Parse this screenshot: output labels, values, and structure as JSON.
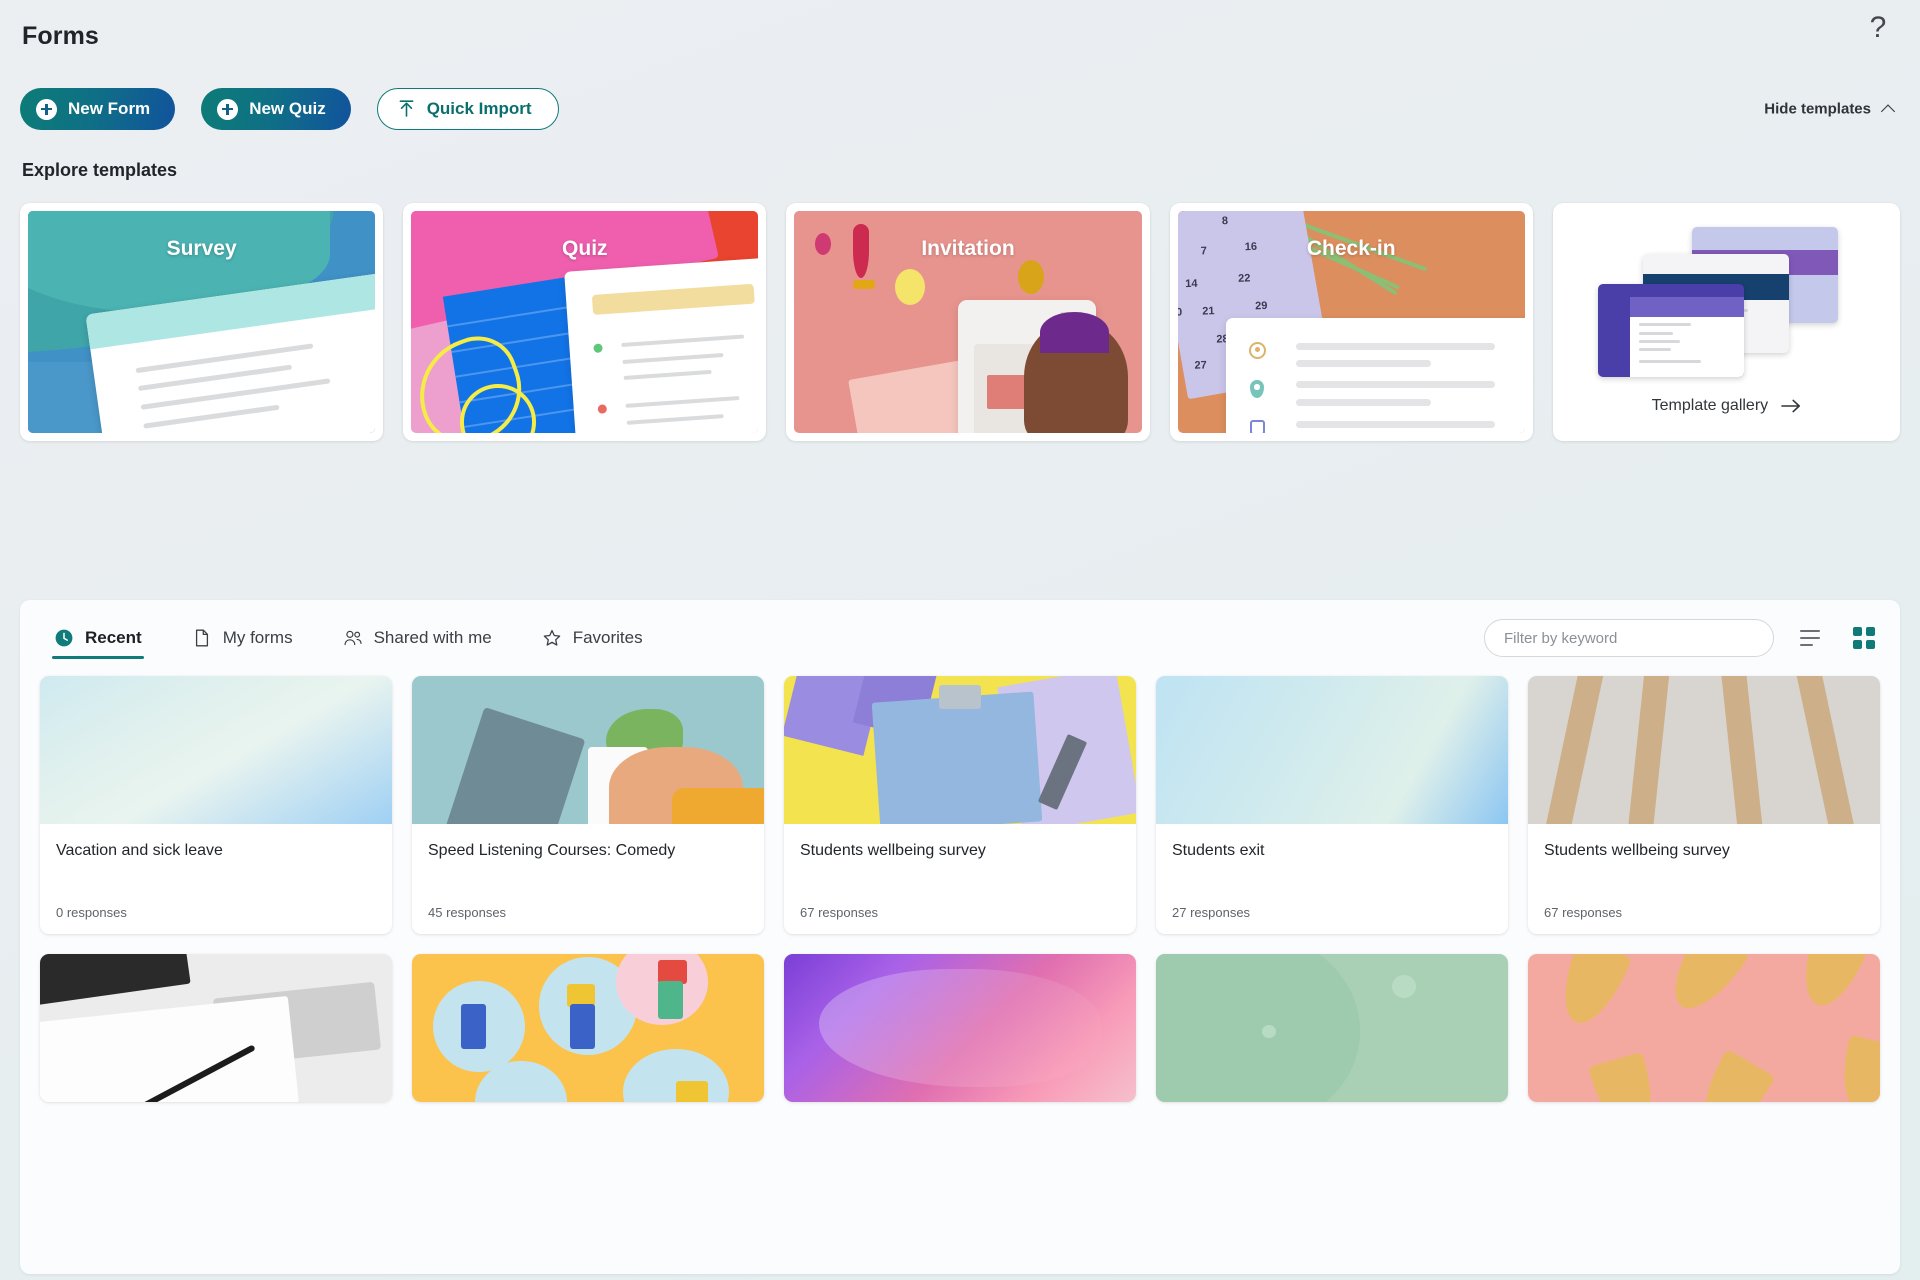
{
  "app": {
    "title": "Forms",
    "help_icon": "question-mark-icon"
  },
  "actions": {
    "new_form": "New Form",
    "new_quiz": "New Quiz",
    "quick_import": "Quick Import",
    "hide_templates": "Hide templates"
  },
  "explore": {
    "heading": "Explore templates",
    "cards": [
      {
        "label": "Survey",
        "accent": "#3fa5a8"
      },
      {
        "label": "Quiz",
        "accent": "#ef5fae"
      },
      {
        "label": "Invitation",
        "accent": "#e8948e"
      },
      {
        "label": "Check-in",
        "accent": "#dd8e5e"
      }
    ],
    "gallery": {
      "label": "Template gallery",
      "arrow_icon": "arrow-right-icon"
    }
  },
  "forms": {
    "tabs": [
      {
        "label": "Recent",
        "icon": "clock-icon",
        "active": true
      },
      {
        "label": "My forms",
        "icon": "document-icon",
        "active": false
      },
      {
        "label": "Shared with me",
        "icon": "people-icon",
        "active": false
      },
      {
        "label": "Favorites",
        "icon": "star-icon",
        "active": false
      }
    ],
    "filter_placeholder": "Filter by keyword",
    "filter_value": "",
    "view_list_icon": "list-view-icon",
    "view_grid_icon": "grid-view-icon",
    "active_view": "grid",
    "items": [
      {
        "title": "Vacation and sick leave",
        "responses": "0 responses"
      },
      {
        "title": "Speed Listening Courses: Comedy",
        "responses": "45 responses"
      },
      {
        "title": "Students wellbeing survey",
        "responses": "67 responses"
      },
      {
        "title": "Students exit",
        "responses": "27 responses"
      },
      {
        "title": "Students wellbeing survey",
        "responses": "67 responses"
      }
    ]
  },
  "colors": {
    "accent_teal": "#0f7a78",
    "button_gradient_start": "#0d7c77",
    "button_gradient_end": "#11539d",
    "page_background": "#eef2f4",
    "panel_background": "#fbfcfd"
  }
}
